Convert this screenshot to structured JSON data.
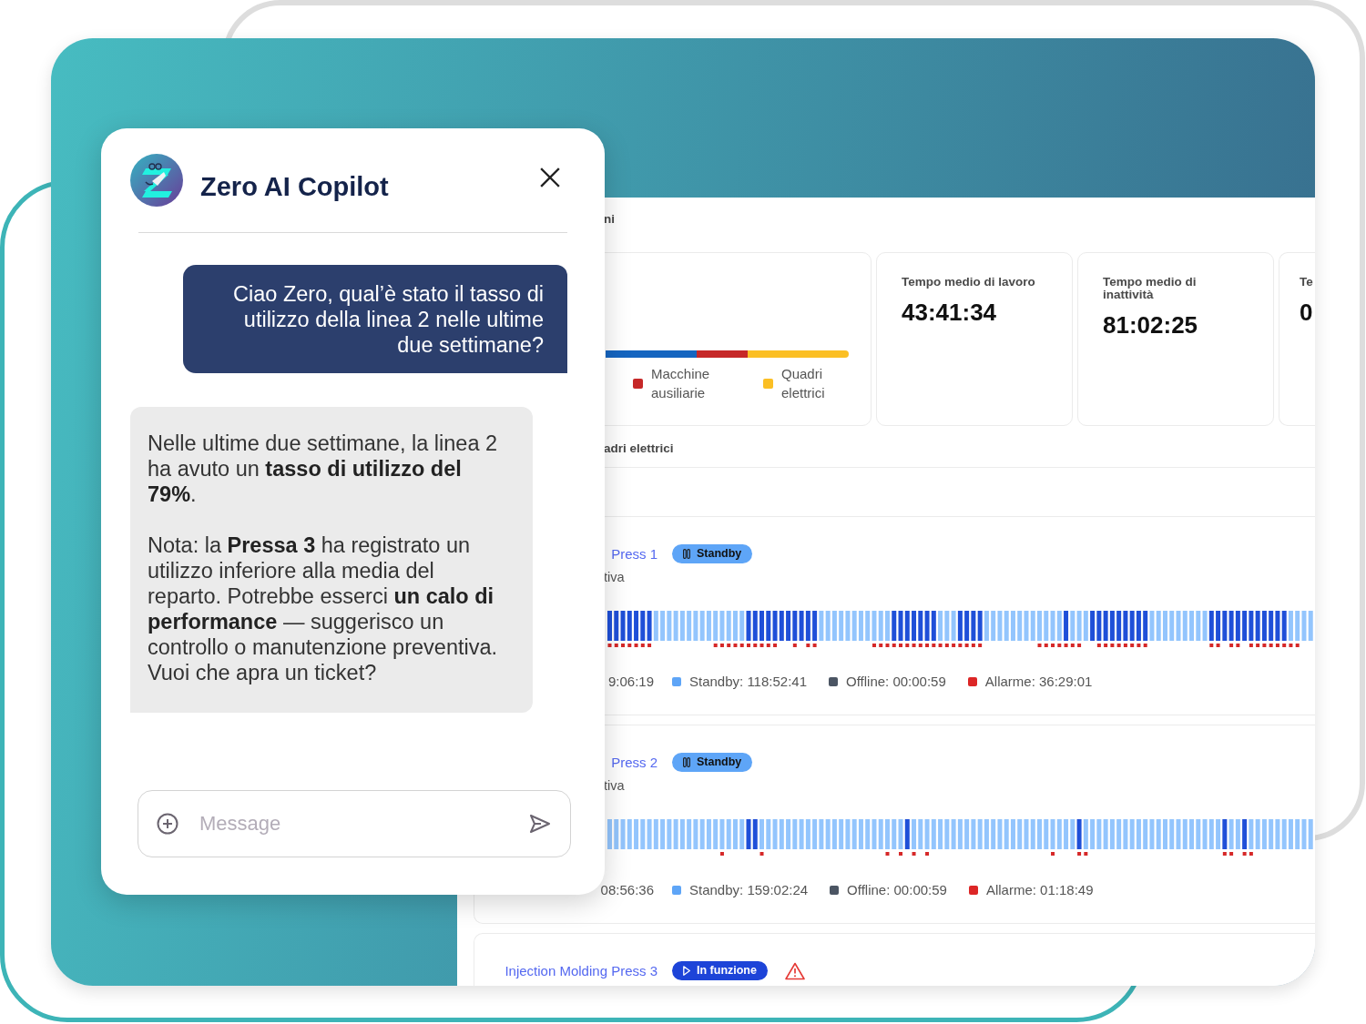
{
  "chat": {
    "title": "Zero AI Copilot",
    "messages": [
      {
        "kind": "user",
        "paragraphs": [
          "Ciao Zero, qual’è stato il tasso di utilizzo della linea 2 nelle ultime due settimane?"
        ]
      },
      {
        "kind": "assistant",
        "paragraphs": [
          "Nelle ultime due settimane, la linea 2 ha avuto un **tasso di utilizzo del 79%**.",
          "Nota: la **Pressa 3** ha registrato un utilizzo inferiore alla media del reparto. Potrebbe esserci **un calo di performance** — suggerisco un controllo o manutenzione preventiva. Vuoi che apra un ticket?"
        ]
      }
    ],
    "input": {
      "placeholder": "Message"
    }
  },
  "dashboard": {
    "section_title": "ni",
    "stat_cards": [
      {
        "kind": "breakdown",
        "legend": [
          {
            "label": "Macchine ausiliarie",
            "color": "#c62828"
          },
          {
            "label": "Quadri elettrici",
            "color": "#fbbf24"
          }
        ]
      },
      {
        "kind": "metric",
        "title": "Tempo medio di lavoro",
        "value": "43:41:34"
      },
      {
        "kind": "metric",
        "title": "Tempo medio di inattività",
        "value": "81:02:25"
      },
      {
        "kind": "metric",
        "title": "Te",
        "value": "0"
      }
    ],
    "list_title": "adri elettrici",
    "machines": [
      {
        "name": "Press 1",
        "status": {
          "kind": "standby",
          "label": "Standby"
        },
        "warning": false,
        "subtitle": "tiva",
        "legend": [
          {
            "label": "9:06:19"
          },
          {
            "label": "Standby: 118:52:41",
            "color": "#5ea5f7"
          },
          {
            "label": "Offline: 00:00:59",
            "color": "#4b5563"
          },
          {
            "label": "Allarme: 36:29:01",
            "color": "#dc2626"
          }
        ]
      },
      {
        "name": "Press 2",
        "status": {
          "kind": "standby",
          "label": "Standby"
        },
        "warning": false,
        "subtitle": "tiva",
        "legend": [
          {
            "label": "08:56:36"
          },
          {
            "label": "Standby: 159:02:24",
            "color": "#5ea5f7"
          },
          {
            "label": "Offline: 00:00:59",
            "color": "#4b5563"
          },
          {
            "label": "Allarme: 01:18:49",
            "color": "#dc2626"
          }
        ]
      },
      {
        "name": "Injection Molding Press 3",
        "status": {
          "kind": "running",
          "label": "In funzione"
        },
        "warning": true
      }
    ]
  }
}
